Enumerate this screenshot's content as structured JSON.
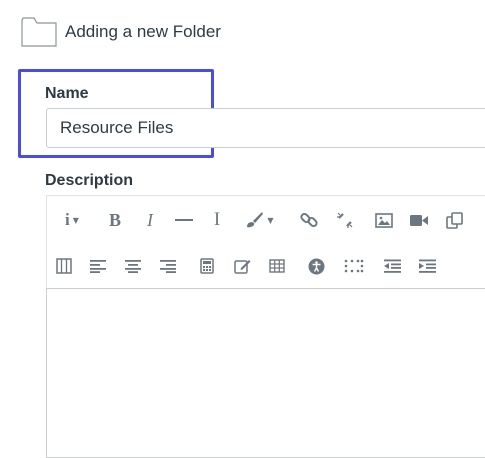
{
  "header": {
    "title": "Adding a new Folder",
    "icon": "folder-icon"
  },
  "form": {
    "name_label": "Name",
    "name_value": "Resource Files",
    "description_label": "Description"
  },
  "toolbar": {
    "row1": [
      "info-icon",
      "bold-icon",
      "italic-icon",
      "horizontal-rule-icon",
      "text-cursor-icon",
      "brush-icon",
      "link-icon",
      "unlink-icon",
      "image-icon",
      "video-icon",
      "embed-icon"
    ],
    "row2": [
      "columns-icon",
      "align-left-icon",
      "align-center-icon",
      "align-right-icon",
      "calculator-icon",
      "edit-icon",
      "table-icon",
      "accessibility-icon",
      "grid-dots-icon",
      "outdent-icon",
      "indent-icon"
    ],
    "bold_glyph": "B",
    "italic_glyph": "I",
    "cursor_glyph": "I"
  },
  "colors": {
    "highlight": "#4a4de2",
    "text": "#2d3b45",
    "icon": "#6b7780"
  }
}
